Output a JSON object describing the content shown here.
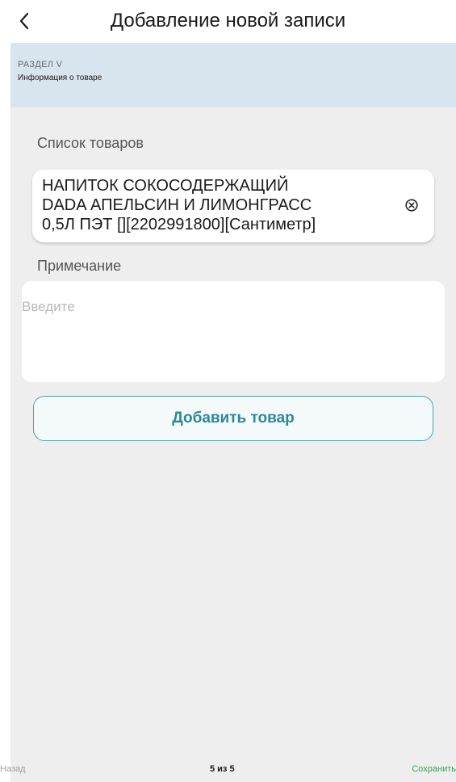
{
  "header": {
    "title": "Добавление новой записи",
    "back_icon": "chevron-left-icon"
  },
  "section": {
    "label": "РАЗДЕЛ V",
    "subtitle": "Информация о товаре"
  },
  "products": {
    "label": "Список товаров",
    "items": [
      {
        "line1": "НАПИТОК СОКОСОДЕРЖАЩИЙ",
        "line2": "DADA АПЕЛЬСИН И ЛИМОНГРАСС",
        "line3": "0,5Л ПЭТ [][2202991800][Сантиметр]",
        "remove_icon": "close-circle-icon"
      }
    ]
  },
  "note": {
    "label": "Примечание",
    "placeholder": "Введите",
    "value": ""
  },
  "add_button": {
    "label": "Добавить товар"
  },
  "footer": {
    "back_label": "Назад",
    "page_indicator": "5 из 5",
    "save_label": "Сохранить"
  },
  "colors": {
    "banner_bg": "#d9e5ee",
    "body_bg": "#eeeeee",
    "accent": "#2b8a98",
    "save": "#3aa34d"
  }
}
